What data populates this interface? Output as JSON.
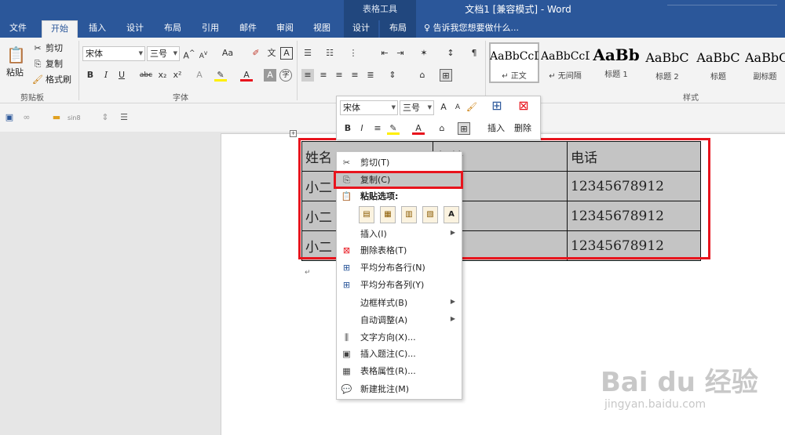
{
  "title_bar": {
    "context_group": "表格工具",
    "document_title": "文档1 [兼容模式] - Word"
  },
  "tabs": [
    {
      "label": "文件"
    },
    {
      "label": "开始"
    },
    {
      "label": "插入"
    },
    {
      "label": "设计"
    },
    {
      "label": "布局"
    },
    {
      "label": "引用"
    },
    {
      "label": "邮件"
    },
    {
      "label": "审阅"
    },
    {
      "label": "视图"
    },
    {
      "label": "设计"
    },
    {
      "label": "布局"
    }
  ],
  "tell_me": {
    "icon": "lightbulb-icon",
    "placeholder": "告诉我您想要做什么..."
  },
  "ribbon": {
    "clipboard": {
      "paste": "粘贴",
      "cut": "剪切",
      "copy": "复制",
      "format_painter": "格式刷",
      "group": "剪贴板"
    },
    "font": {
      "font_name": "宋体",
      "font_size": "三号",
      "group": "字体",
      "change_case": "Aa",
      "bold": "B",
      "italic": "I",
      "underline": "U",
      "strike": "abc",
      "subscript": "x₂",
      "superscript": "x²"
    },
    "paragraph": {
      "group": "段落"
    },
    "styles": {
      "group": "样式",
      "items": [
        {
          "sample": "AaBbCcDd",
          "name": "↵ 正文"
        },
        {
          "sample": "AaBbCcDd",
          "name": "↵ 无间隔"
        },
        {
          "sample": "AaBb",
          "name": "标题 1"
        },
        {
          "sample": "AaBbC",
          "name": "标题 2"
        },
        {
          "sample": "AaBbC",
          "name": "标题"
        },
        {
          "sample": "AaBbC",
          "name": "副标题"
        }
      ]
    }
  },
  "qat": {
    "zoom_label": "sin8"
  },
  "table": {
    "rows": [
      [
        "姓名",
        "年龄",
        "电话"
      ],
      [
        "小二",
        "",
        "12345678912"
      ],
      [
        "小二",
        "",
        "12345678912"
      ],
      [
        "小二",
        "",
        "12345678912"
      ]
    ]
  },
  "mini_toolbar": {
    "font_name": "宋体",
    "font_size": "三号",
    "insert": "插入",
    "delete": "删除"
  },
  "context_menu": {
    "cut": "剪切(T)",
    "copy": "复制(C)",
    "paste_options": "粘贴选项:",
    "insert": "插入(I)",
    "delete_table": "删除表格(T)",
    "distribute_rows": "平均分布各行(N)",
    "distribute_cols": "平均分布各列(Y)",
    "border_styles": "边框样式(B)",
    "autofit": "自动调整(A)",
    "text_direction": "文字方向(X)...",
    "insert_caption": "插入题注(C)...",
    "table_properties": "表格属性(R)...",
    "new_comment": "新建批注(M)"
  },
  "watermark": {
    "brand": "Bai du 经验",
    "url": "jingyan.baidu.com"
  },
  "colors": {
    "accent": "#2b579a",
    "highlight_red": "#e8141d",
    "cell_gray": "#c4c4c4"
  }
}
